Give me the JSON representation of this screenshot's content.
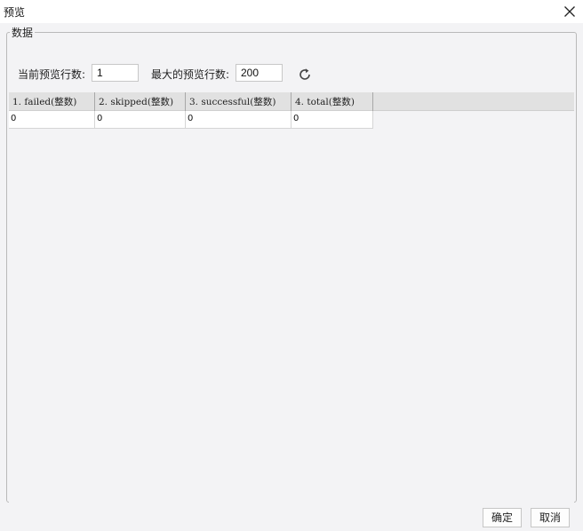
{
  "window": {
    "title": "预览",
    "close_icon": "close-icon"
  },
  "data_group": {
    "legend": "数据",
    "current_rows_label": "当前预览行数:",
    "current_rows_value": "1",
    "max_rows_label": "最大的预览行数:",
    "max_rows_value": "200",
    "refresh_icon": "refresh-icon"
  },
  "table": {
    "columns": [
      "1. failed(整数)",
      "2. skipped(整数)",
      "3. successful(整数)",
      "4. total(整数)"
    ],
    "rows": [
      [
        "0",
        "0",
        "0",
        "0"
      ]
    ]
  },
  "footer": {
    "ok_label": "确定",
    "cancel_label": "取消"
  }
}
